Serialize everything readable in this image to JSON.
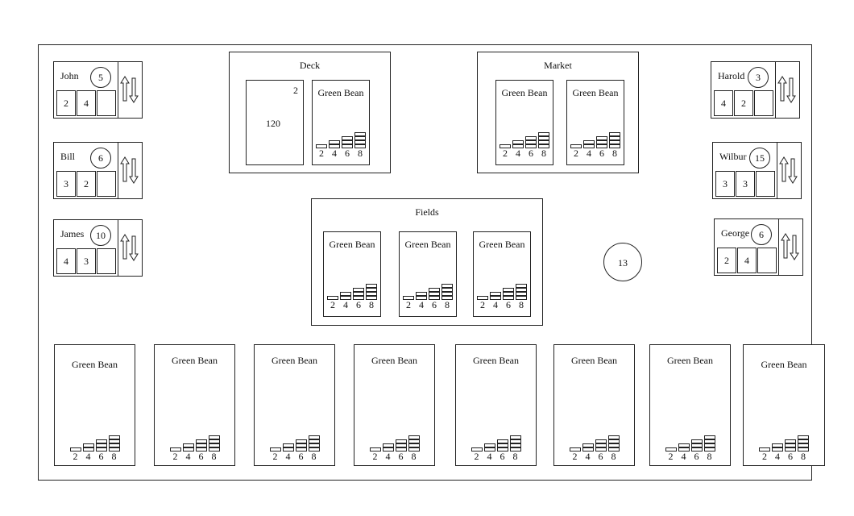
{
  "card_name": "Green Bean",
  "ladder_numbers": [
    "2",
    "4",
    "6",
    "8"
  ],
  "players_left": [
    {
      "name": "John",
      "coins": "5",
      "slots": [
        "2",
        "4",
        ""
      ]
    },
    {
      "name": "Bill",
      "coins": "6",
      "slots": [
        "3",
        "2",
        ""
      ]
    },
    {
      "name": "James",
      "coins": "10",
      "slots": [
        "4",
        "3",
        ""
      ]
    }
  ],
  "players_right": [
    {
      "name": "Harold",
      "coins": "3",
      "slots": [
        "4",
        "2",
        ""
      ]
    },
    {
      "name": "Wilbur",
      "coins": "15",
      "slots": [
        "3",
        "3",
        ""
      ]
    },
    {
      "name": "George",
      "coins": "6",
      "slots": [
        "2",
        "4",
        ""
      ]
    }
  ],
  "deck": {
    "title": "Deck",
    "count": "120",
    "corner": "2"
  },
  "market": {
    "title": "Market"
  },
  "fields": {
    "title": "Fields"
  },
  "center_coin": "13",
  "hand_count": 8
}
